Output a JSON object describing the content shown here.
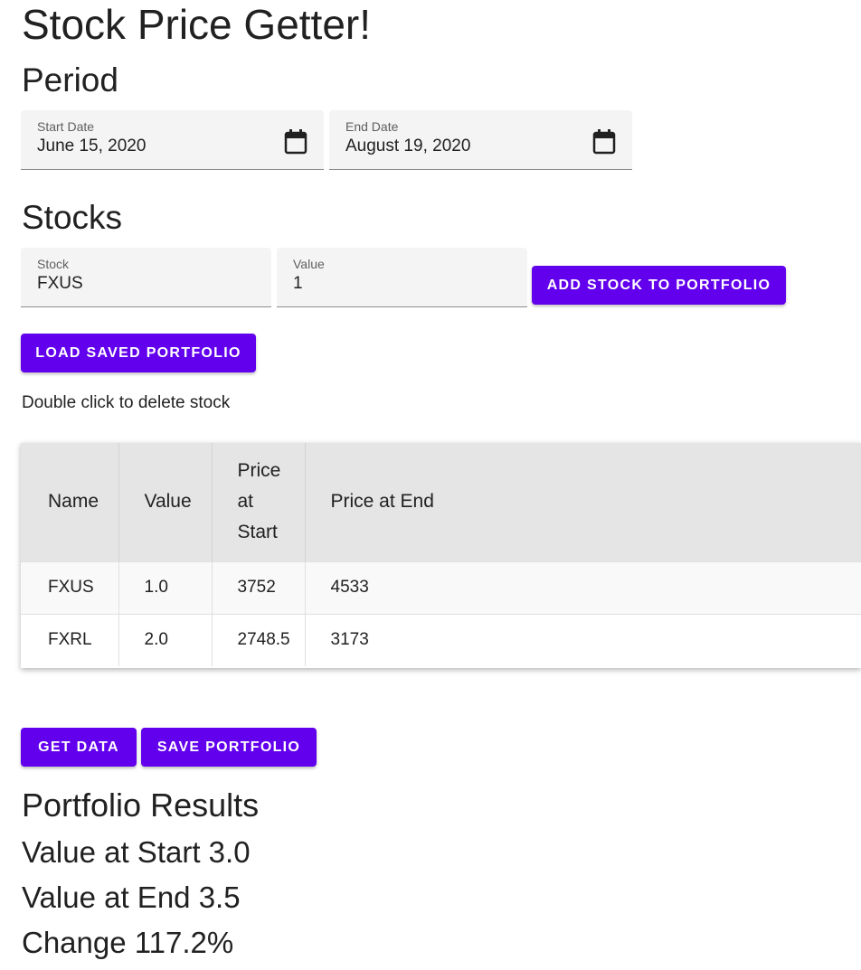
{
  "page_title": "Stock Price Getter!",
  "period": {
    "heading": "Period",
    "start_date": {
      "label": "Start Date",
      "value": "June 15, 2020"
    },
    "end_date": {
      "label": "End Date",
      "value": "August 19, 2020"
    }
  },
  "stocks": {
    "heading": "Stocks",
    "stock_field": {
      "label": "Stock",
      "value": "FXUS"
    },
    "value_field": {
      "label": "Value",
      "value": "1"
    },
    "add_button": "ADD STOCK TO PORTFOLIO",
    "load_button": "LOAD SAVED PORTFOLIO",
    "hint": "Double click to delete stock"
  },
  "table": {
    "columns": [
      "Name",
      "Value",
      "Price at Start",
      "Price at End"
    ],
    "rows": [
      [
        "FXUS",
        "1.0",
        "3752",
        "4533"
      ],
      [
        "FXRL",
        "2.0",
        "2748.5",
        "3173"
      ]
    ]
  },
  "actions": {
    "get_data": "GET DATA",
    "save_portfolio": "SAVE PORTFOLIO"
  },
  "results": {
    "heading": "Portfolio Results",
    "value_start": "Value at Start 3.0",
    "value_end": "Value at End 3.5",
    "change": "Change 117.2%"
  },
  "colors": {
    "accent": "#6200ee",
    "field_bg": "#f4f4f4",
    "header_bg": "#e5e5e5"
  },
  "icons": {
    "date_picker": "calendar-icon"
  }
}
